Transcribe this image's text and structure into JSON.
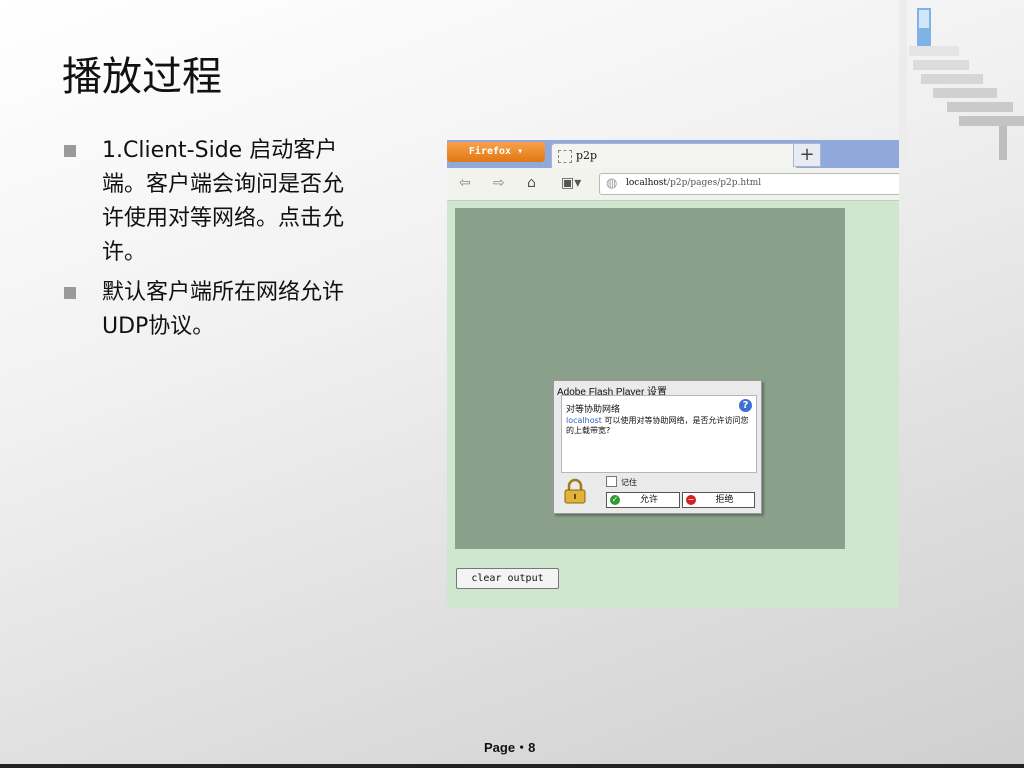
{
  "slide": {
    "title": "播放过程",
    "bullets": [
      "1.Client-Side 启动客户端。客户端会询问是否允许使用对等网络。点击允许。",
      "默认客户端所在网络允许UDP协议。"
    ],
    "page_label": "Page・8"
  },
  "browser": {
    "menu_button": "Firefox ▾",
    "tab_title": "p2p",
    "new_tab": "+",
    "url_host": "localhost",
    "url_path": "/p2p/pages/p2p.html",
    "clear_button": "clear output"
  },
  "flash_dialog": {
    "title": "Adobe Flash Player 设置",
    "heading": "对等协助网络",
    "message_host": "localhost",
    "message_text": " 可以使用对等协助网络，是否允许访问您的上载带宽?",
    "remember_label": "记住",
    "allow_label": "允许",
    "deny_label": "拒绝"
  },
  "icons": {
    "back": "back-arrow-icon",
    "forward": "forward-arrow-icon",
    "home": "home-icon",
    "bookmark": "bookmark-icon",
    "globe": "globe-icon",
    "help": "help-icon",
    "lock": "lock-icon",
    "allow": "check-icon",
    "deny": "minus-icon"
  }
}
